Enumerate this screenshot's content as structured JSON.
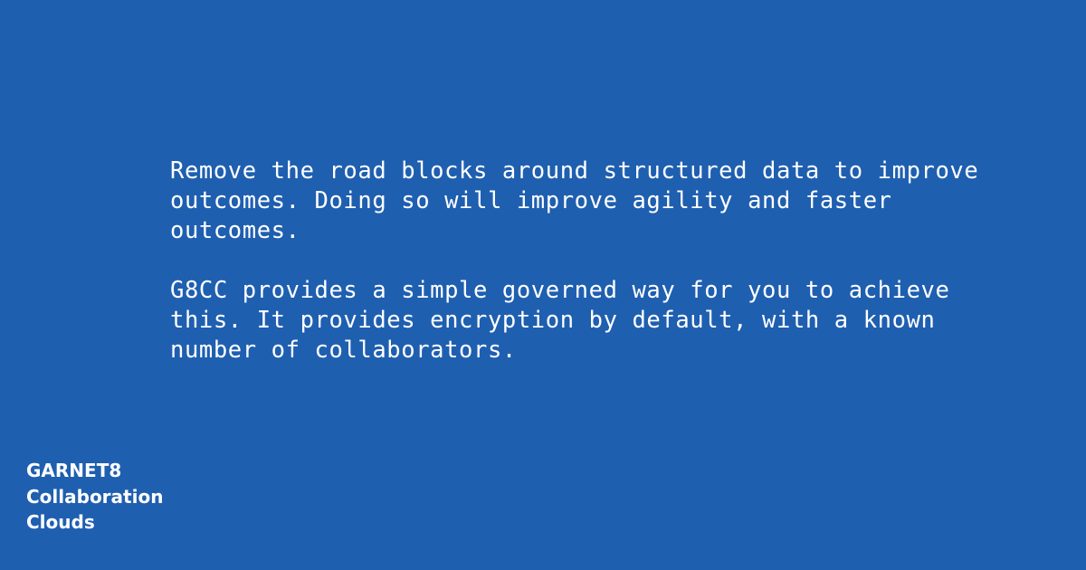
{
  "main": {
    "paragraph_1": "Remove the road blocks around structured data to improve\noutcomes. Doing so will improve agility and faster\noutcomes.",
    "paragraph_2": "G8CC provides a simple governed way for you to achieve\nthis. It provides encryption by default, with a known\nnumber of collaborators."
  },
  "brand": {
    "line_1": "GARNET8",
    "line_2": "Collaboration",
    "line_3": "Clouds"
  },
  "colors": {
    "background": "#1f5fb0",
    "text": "#ffffff"
  }
}
